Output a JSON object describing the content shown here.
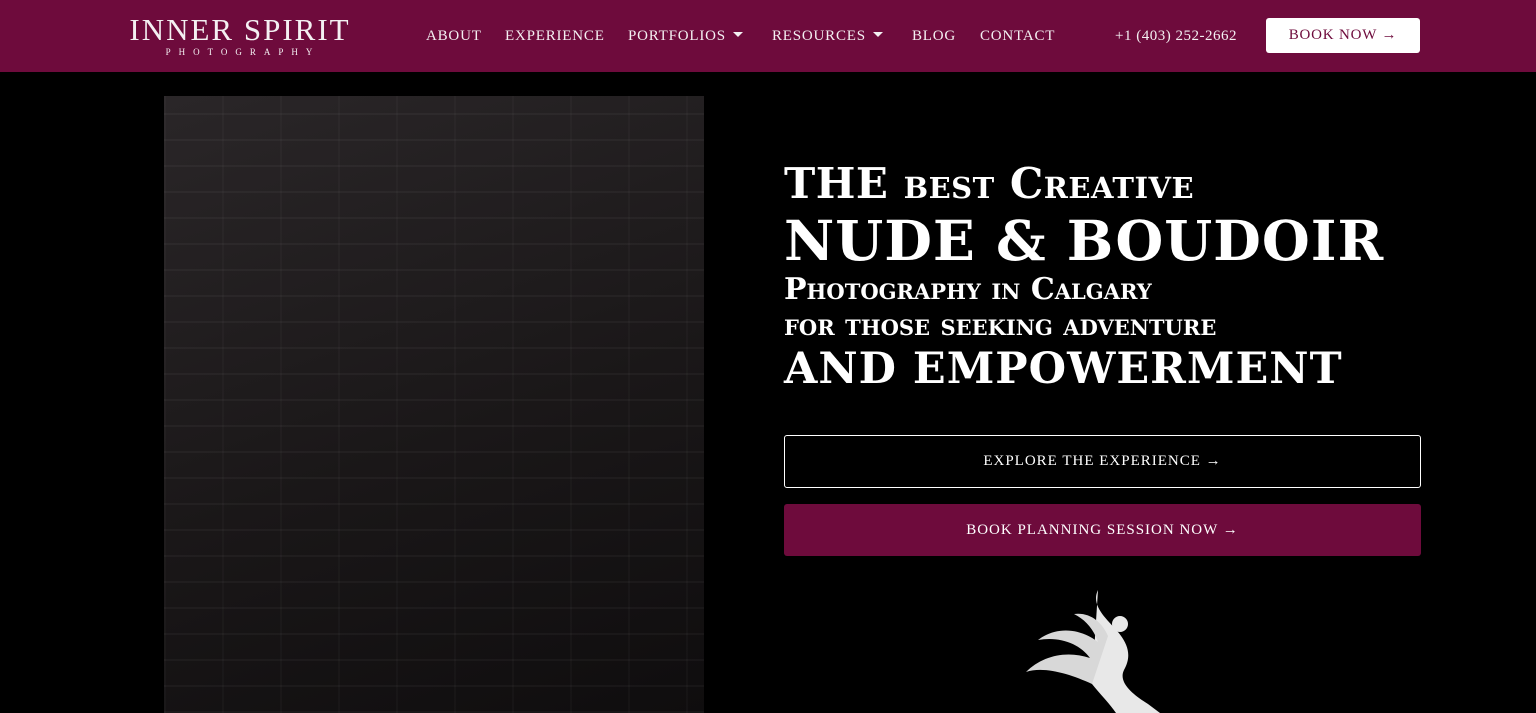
{
  "brand": {
    "logo_main": "INNER SPIRIT",
    "logo_sub": "PHOTOGRAPHY",
    "accent_color": "#6e0b3c"
  },
  "nav": {
    "about": "ABOUT",
    "experience": "EXPERIENCE",
    "portfolios": "PORTFOLIOS",
    "resources": "RESOURCES",
    "blog": "BLOG",
    "contact": "CONTACT"
  },
  "header": {
    "phone": "+1 (403) 252-2662",
    "book_now": "BOOK NOW →"
  },
  "hero": {
    "line1": "THE best Creative",
    "line2": "NUDE & BOUDOIR",
    "line3": "Photography in Calgary",
    "line4": "for those seeking adventure",
    "line5": "AND EMPOWERMENT",
    "explore_button": "EXPLORE THE EXPERIENCE →",
    "planning_button": "BOOK PLANNING SESSION NOW →"
  }
}
